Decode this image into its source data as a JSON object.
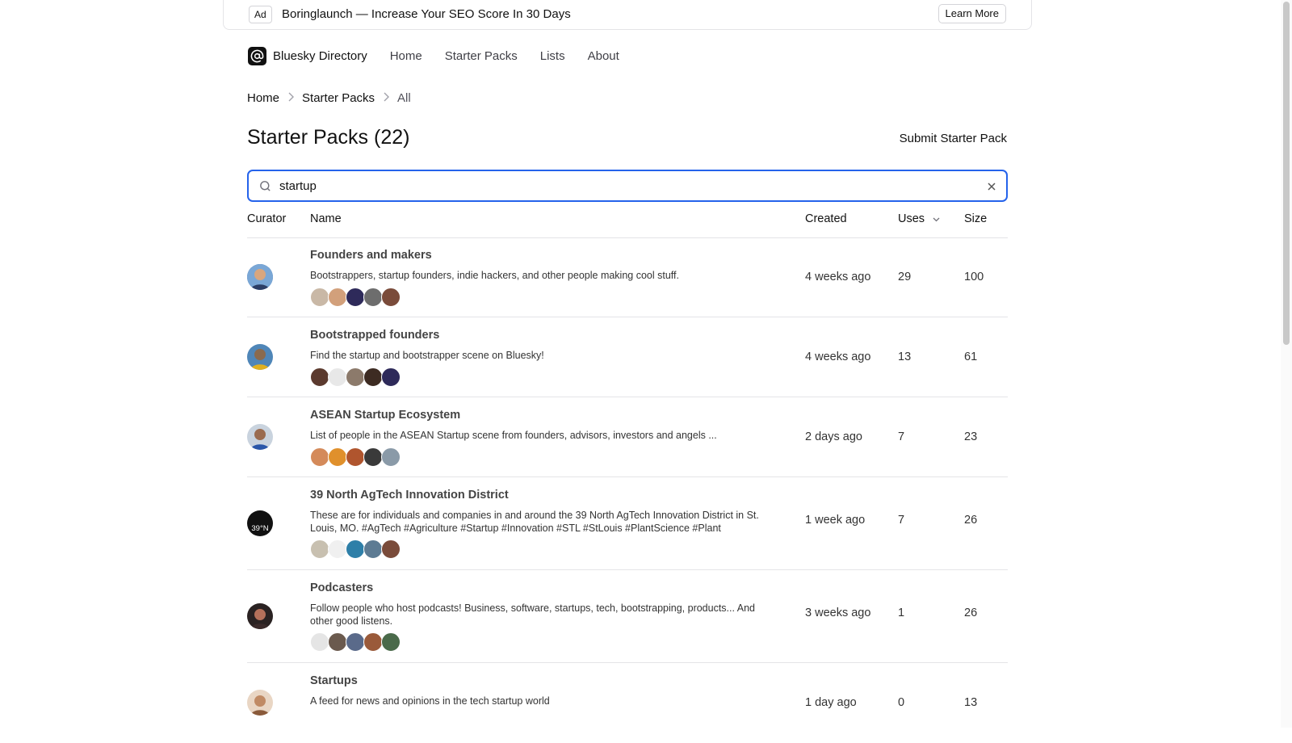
{
  "ad": {
    "tag": "Ad",
    "text": "Boringlaunch — Increase Your SEO Score In 30 Days",
    "cta": "Learn More"
  },
  "nav": {
    "brand": "Bluesky Directory",
    "links": [
      "Home",
      "Starter Packs",
      "Lists",
      "About"
    ]
  },
  "breadcrumb": [
    "Home",
    "Starter Packs",
    "All"
  ],
  "page": {
    "title": "Starter Packs (22)",
    "submit_label": "Submit Starter Pack"
  },
  "search": {
    "value": "startup",
    "placeholder": "Search"
  },
  "table": {
    "headers": {
      "curator": "Curator",
      "name": "Name",
      "created": "Created",
      "uses": "Uses",
      "size": "Size"
    },
    "sort": "Uses descending",
    "rows": [
      {
        "name": "Founders and makers",
        "description": "Bootstrappers, startup founders, indie hackers, and other people making cool stuff.",
        "created": "4 weeks ago",
        "uses": "29",
        "size": "100"
      },
      {
        "name": "Bootstrapped founders",
        "description": "Find the startup and bootstrapper scene on Bluesky!",
        "created": "4 weeks ago",
        "uses": "13",
        "size": "61"
      },
      {
        "name": "ASEAN Startup Ecosystem",
        "description": "List of people in the ASEAN Startup scene from founders, advisors, investors and angels ...",
        "created": "2 days ago",
        "uses": "7",
        "size": "23"
      },
      {
        "name": "39 North AgTech Innovation District",
        "description": "These are for individuals and companies in and around the 39 North AgTech Innovation District in St. Louis, MO. #AgTech #Agriculture #Startup #Innovation #STL #StLouis #PlantScience #Plant",
        "created": "1 week ago",
        "uses": "7",
        "size": "26",
        "curator_avatar_text": "39°N"
      },
      {
        "name": "Podcasters",
        "description": "Follow people who host podcasts! Business, software, startups, tech, bootstrapping, products... And other good listens.",
        "created": "3 weeks ago",
        "uses": "1",
        "size": "26"
      },
      {
        "name": "Startups",
        "description": "A feed for news and opinions in the tech startup world",
        "created": "1 day ago",
        "uses": "0",
        "size": "13"
      }
    ]
  },
  "colors": {
    "accent": "#2563eb",
    "border": "#e4e4e7",
    "text": "#111111",
    "muted": "#52525b"
  }
}
